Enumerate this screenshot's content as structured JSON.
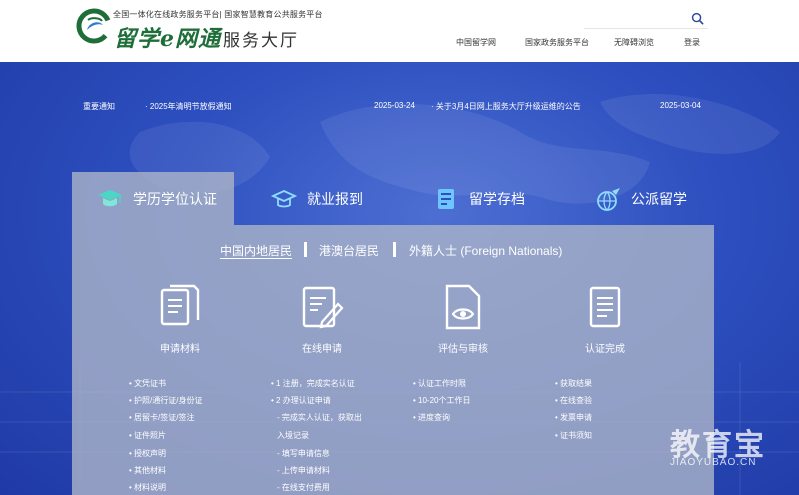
{
  "header": {
    "logo_subtitle": "全国一体化在线政务服务平台| 国家智慧教育公共服务平台",
    "logo_brand": "留学e网通",
    "logo_hall": "服务大厅",
    "search": {
      "placeholder": "",
      "icon": "search-icon"
    },
    "nav": [
      "中国留学网",
      "国家政务服务平台",
      "无障碍浏览",
      "登录"
    ]
  },
  "notice_bar": {
    "label": "重要通知",
    "items": [
      {
        "title": "· 2025年清明节放假通知",
        "date": "2025-03-24"
      },
      {
        "title": "· 关于3月4日网上服务大厅升级运维的公告",
        "date": "2025-03-04"
      }
    ]
  },
  "main_tabs": [
    {
      "label": "学历学位认证",
      "icon": "graduation-cap-icon",
      "active": true
    },
    {
      "label": "就业报到",
      "icon": "cap-badge-icon",
      "active": false
    },
    {
      "label": "留学存档",
      "icon": "archive-folder-icon",
      "active": false
    },
    {
      "label": "公派留学",
      "icon": "globe-plane-icon",
      "active": false
    }
  ],
  "sub_tabs": [
    "中国内地居民",
    "港澳台居民",
    "外籍人士 (Foreign Nationals)"
  ],
  "steps": [
    {
      "label": "申请材料",
      "icon": "documents-icon",
      "items": [
        "• 文凭证书",
        "• 护照/通行证/身份证",
        "• 居留卡/签证/签注",
        "• 证件照片",
        "• 授权声明",
        "• 其他材料",
        "• 材料说明"
      ]
    },
    {
      "label": "在线申请",
      "icon": "edit-form-icon",
      "items": [
        "• 1 注册，完成实名认证",
        "• 2 办理认证申请",
        "- 完成实人认证，获取出",
        "入境记录",
        "- 填写申请信息",
        "- 上传申请材料",
        "- 在线支付费用"
      ]
    },
    {
      "label": "评估与审核",
      "icon": "document-eye-icon",
      "items": [
        "• 认证工作时限",
        "• 10-20个工作日",
        "• 进度查询"
      ]
    },
    {
      "label": "认证完成",
      "icon": "certificate-icon",
      "items": [
        "• 获取结果",
        "• 在线查验",
        "• 发票申请",
        "• 证书须知"
      ]
    }
  ],
  "watermark": {
    "cn": "教育宝",
    "en": "JIAOYUBAO.CN"
  },
  "colors": {
    "brand_green": "#1f6e3a",
    "hero_blue": "#2d4fbf",
    "panel_gray": "#aab2c8"
  }
}
